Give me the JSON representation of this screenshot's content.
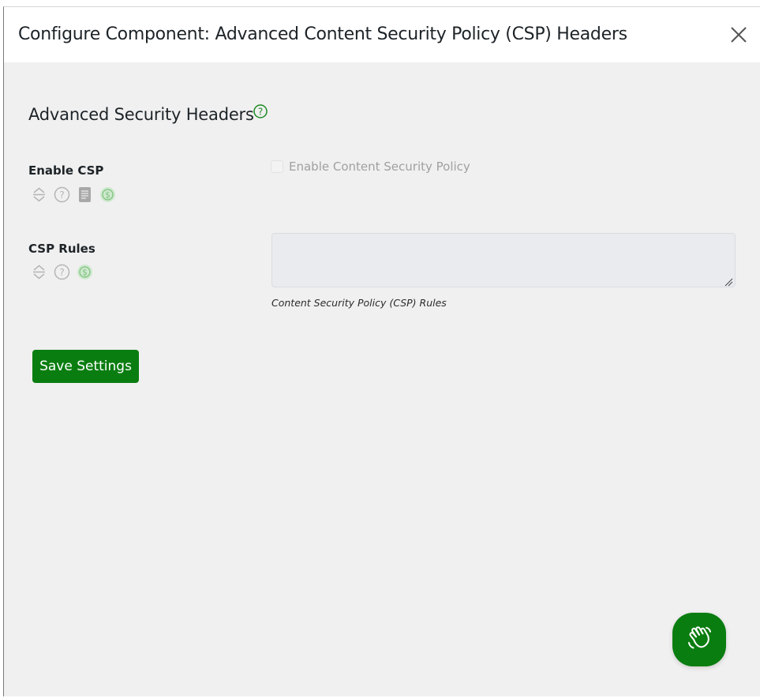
{
  "modal": {
    "title": "Configure Component: Advanced Content Security Policy (CSP) Headers"
  },
  "section": {
    "title": "Advanced Security Headers"
  },
  "fields": [
    {
      "label": "Enable CSP",
      "control": "checkbox",
      "checkbox_label": "Enable Content Security Policy",
      "checked": false,
      "icons": [
        "sort-arrows-icon",
        "help-icon",
        "document-icon",
        "dollar-icon"
      ]
    },
    {
      "label": "CSP Rules",
      "control": "textarea",
      "value": "",
      "description": "Content Security Policy (CSP) Rules",
      "icons": [
        "sort-arrows-icon",
        "help-icon",
        "dollar-icon"
      ]
    }
  ],
  "actions": {
    "save_label": "Save Settings"
  },
  "colors": {
    "accent": "#0a7d10",
    "modal_background": "#f0f0f0",
    "header_background": "#ffffff"
  }
}
